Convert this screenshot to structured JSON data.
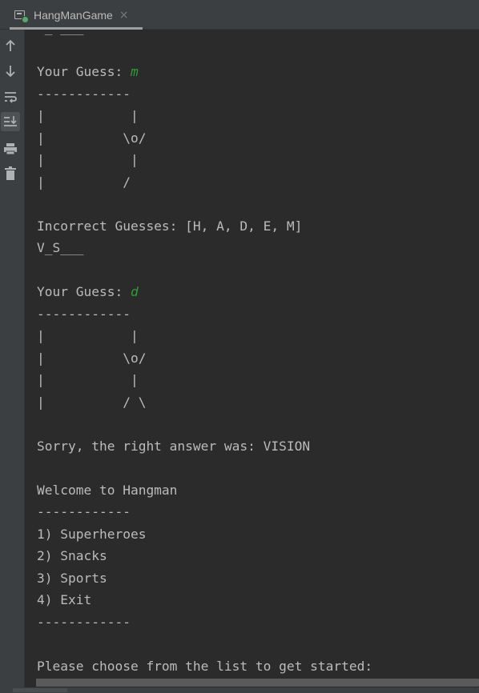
{
  "tab": {
    "title": "HangManGame",
    "close_glyph": "×",
    "icon": "run-console-icon",
    "status_dot_color": "#59a869"
  },
  "toolbar": {
    "buttons": [
      {
        "name": "scroll-up-icon",
        "glyph": "↑"
      },
      {
        "name": "scroll-down-icon",
        "glyph": "↓"
      },
      {
        "name": "soft-wrap-icon",
        "glyph": "wrap"
      },
      {
        "name": "scroll-to-end-icon",
        "glyph": "end",
        "active": true
      },
      {
        "name": "print-icon",
        "glyph": "print"
      },
      {
        "name": "trash-icon",
        "glyph": "trash"
      }
    ]
  },
  "console": {
    "input_color": "#2a9f36",
    "lines": [
      {
        "text": " _ ___"
      },
      {
        "text": ""
      },
      {
        "text": "Your Guess: ",
        "input": "m"
      },
      {
        "text": "------------"
      },
      {
        "text": "|           |"
      },
      {
        "text": "|          \\o/"
      },
      {
        "text": "|           |"
      },
      {
        "text": "|          /"
      },
      {
        "text": ""
      },
      {
        "text": "Incorrect Guesses: [H, A, D, E, M]"
      },
      {
        "text": "V_S___"
      },
      {
        "text": ""
      },
      {
        "text": "Your Guess: ",
        "input": "d"
      },
      {
        "text": "------------"
      },
      {
        "text": "|           |"
      },
      {
        "text": "|          \\o/"
      },
      {
        "text": "|           |"
      },
      {
        "text": "|          / \\"
      },
      {
        "text": ""
      },
      {
        "text": "Sorry, the right answer was: VISION"
      },
      {
        "text": ""
      },
      {
        "text": "Welcome to Hangman"
      },
      {
        "text": "------------"
      },
      {
        "text": "1) Superheroes"
      },
      {
        "text": "2) Snacks"
      },
      {
        "text": "3) Sports"
      },
      {
        "text": "4) Exit"
      },
      {
        "text": "------------"
      },
      {
        "text": ""
      },
      {
        "text": "Please choose from the list to get started:"
      }
    ]
  }
}
